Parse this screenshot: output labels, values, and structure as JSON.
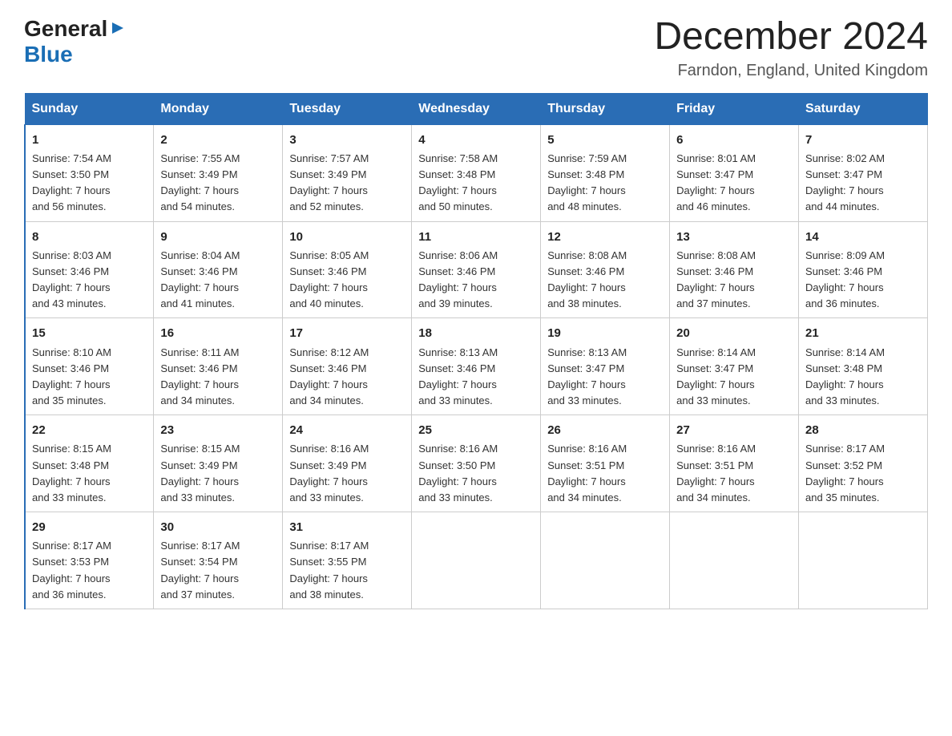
{
  "logo": {
    "general": "General",
    "arrow": "▶",
    "blue": "Blue"
  },
  "title": "December 2024",
  "location": "Farndon, England, United Kingdom",
  "weekdays": [
    "Sunday",
    "Monday",
    "Tuesday",
    "Wednesday",
    "Thursday",
    "Friday",
    "Saturday"
  ],
  "weeks": [
    [
      {
        "day": "1",
        "info": "Sunrise: 7:54 AM\nSunset: 3:50 PM\nDaylight: 7 hours\nand 56 minutes."
      },
      {
        "day": "2",
        "info": "Sunrise: 7:55 AM\nSunset: 3:49 PM\nDaylight: 7 hours\nand 54 minutes."
      },
      {
        "day": "3",
        "info": "Sunrise: 7:57 AM\nSunset: 3:49 PM\nDaylight: 7 hours\nand 52 minutes."
      },
      {
        "day": "4",
        "info": "Sunrise: 7:58 AM\nSunset: 3:48 PM\nDaylight: 7 hours\nand 50 minutes."
      },
      {
        "day": "5",
        "info": "Sunrise: 7:59 AM\nSunset: 3:48 PM\nDaylight: 7 hours\nand 48 minutes."
      },
      {
        "day": "6",
        "info": "Sunrise: 8:01 AM\nSunset: 3:47 PM\nDaylight: 7 hours\nand 46 minutes."
      },
      {
        "day": "7",
        "info": "Sunrise: 8:02 AM\nSunset: 3:47 PM\nDaylight: 7 hours\nand 44 minutes."
      }
    ],
    [
      {
        "day": "8",
        "info": "Sunrise: 8:03 AM\nSunset: 3:46 PM\nDaylight: 7 hours\nand 43 minutes."
      },
      {
        "day": "9",
        "info": "Sunrise: 8:04 AM\nSunset: 3:46 PM\nDaylight: 7 hours\nand 41 minutes."
      },
      {
        "day": "10",
        "info": "Sunrise: 8:05 AM\nSunset: 3:46 PM\nDaylight: 7 hours\nand 40 minutes."
      },
      {
        "day": "11",
        "info": "Sunrise: 8:06 AM\nSunset: 3:46 PM\nDaylight: 7 hours\nand 39 minutes."
      },
      {
        "day": "12",
        "info": "Sunrise: 8:08 AM\nSunset: 3:46 PM\nDaylight: 7 hours\nand 38 minutes."
      },
      {
        "day": "13",
        "info": "Sunrise: 8:08 AM\nSunset: 3:46 PM\nDaylight: 7 hours\nand 37 minutes."
      },
      {
        "day": "14",
        "info": "Sunrise: 8:09 AM\nSunset: 3:46 PM\nDaylight: 7 hours\nand 36 minutes."
      }
    ],
    [
      {
        "day": "15",
        "info": "Sunrise: 8:10 AM\nSunset: 3:46 PM\nDaylight: 7 hours\nand 35 minutes."
      },
      {
        "day": "16",
        "info": "Sunrise: 8:11 AM\nSunset: 3:46 PM\nDaylight: 7 hours\nand 34 minutes."
      },
      {
        "day": "17",
        "info": "Sunrise: 8:12 AM\nSunset: 3:46 PM\nDaylight: 7 hours\nand 34 minutes."
      },
      {
        "day": "18",
        "info": "Sunrise: 8:13 AM\nSunset: 3:46 PM\nDaylight: 7 hours\nand 33 minutes."
      },
      {
        "day": "19",
        "info": "Sunrise: 8:13 AM\nSunset: 3:47 PM\nDaylight: 7 hours\nand 33 minutes."
      },
      {
        "day": "20",
        "info": "Sunrise: 8:14 AM\nSunset: 3:47 PM\nDaylight: 7 hours\nand 33 minutes."
      },
      {
        "day": "21",
        "info": "Sunrise: 8:14 AM\nSunset: 3:48 PM\nDaylight: 7 hours\nand 33 minutes."
      }
    ],
    [
      {
        "day": "22",
        "info": "Sunrise: 8:15 AM\nSunset: 3:48 PM\nDaylight: 7 hours\nand 33 minutes."
      },
      {
        "day": "23",
        "info": "Sunrise: 8:15 AM\nSunset: 3:49 PM\nDaylight: 7 hours\nand 33 minutes."
      },
      {
        "day": "24",
        "info": "Sunrise: 8:16 AM\nSunset: 3:49 PM\nDaylight: 7 hours\nand 33 minutes."
      },
      {
        "day": "25",
        "info": "Sunrise: 8:16 AM\nSunset: 3:50 PM\nDaylight: 7 hours\nand 33 minutes."
      },
      {
        "day": "26",
        "info": "Sunrise: 8:16 AM\nSunset: 3:51 PM\nDaylight: 7 hours\nand 34 minutes."
      },
      {
        "day": "27",
        "info": "Sunrise: 8:16 AM\nSunset: 3:51 PM\nDaylight: 7 hours\nand 34 minutes."
      },
      {
        "day": "28",
        "info": "Sunrise: 8:17 AM\nSunset: 3:52 PM\nDaylight: 7 hours\nand 35 minutes."
      }
    ],
    [
      {
        "day": "29",
        "info": "Sunrise: 8:17 AM\nSunset: 3:53 PM\nDaylight: 7 hours\nand 36 minutes."
      },
      {
        "day": "30",
        "info": "Sunrise: 8:17 AM\nSunset: 3:54 PM\nDaylight: 7 hours\nand 37 minutes."
      },
      {
        "day": "31",
        "info": "Sunrise: 8:17 AM\nSunset: 3:55 PM\nDaylight: 7 hours\nand 38 minutes."
      },
      {
        "day": "",
        "info": ""
      },
      {
        "day": "",
        "info": ""
      },
      {
        "day": "",
        "info": ""
      },
      {
        "day": "",
        "info": ""
      }
    ]
  ]
}
